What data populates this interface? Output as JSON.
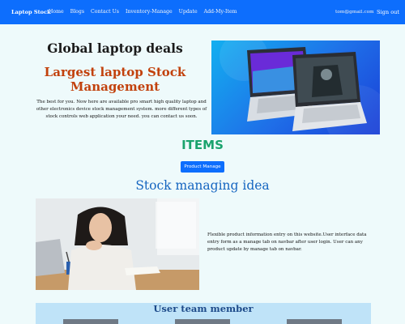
{
  "navbar": {
    "brand": "Laptop Stock",
    "links": [
      "Home",
      "Blogs",
      "Contact Us",
      "Inventory-Manage",
      "Update",
      "Add-My-Item"
    ],
    "email": "tom@gmail.com",
    "signout": "Sign out"
  },
  "hero": {
    "title": "Global laptop deals",
    "subtitle": "Largest laptop Stock Management",
    "description": "The best for you. Now here are available pro smart high quality laptop and other electronics device stock management system. more different types of stock controls web application your need. you can contact us soon."
  },
  "items": {
    "heading": "ITEMS",
    "button_label": "Product Manage"
  },
  "idea": {
    "heading": "Stock managing idea",
    "description": "Flexible product information entry on this website.User interface data entry form as a manage tab on navbar after user login. User can any product update by manage tab on navbar."
  },
  "team": {
    "heading": "User team member"
  },
  "colors": {
    "primary": "#0d6efd",
    "accent_orange": "#c2410c",
    "items_green": "#1aa36d",
    "heading_blue": "#1565c0",
    "page_bg": "#eefafb",
    "team_bg": "#bfe3f8"
  }
}
